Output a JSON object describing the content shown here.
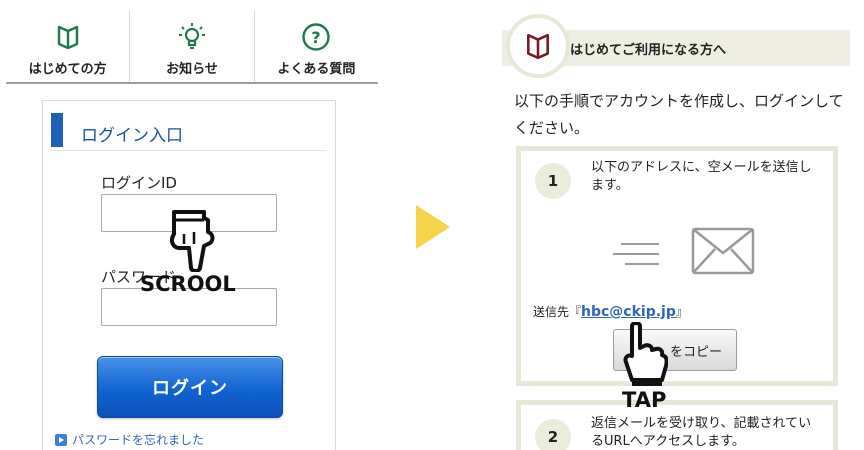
{
  "left": {
    "nav": [
      {
        "label": "はじめての方",
        "icon": "book-icon"
      },
      {
        "label": "お知らせ",
        "icon": "lightbulb-icon"
      },
      {
        "label": "よくある質問",
        "icon": "question-circle-icon"
      }
    ],
    "login": {
      "title": "ログイン入口",
      "id_label": "ログインID",
      "id_value": "",
      "password_label": "パスワード",
      "password_value": "",
      "button_label": "ログイン",
      "forgot_link": "パスワードを忘れました"
    },
    "gesture_label": "SCROOL"
  },
  "right": {
    "header_title": "はじめてご利用になる方へ",
    "intro": "以下の手順でアカウントを作成し、ログインしてください。",
    "steps": [
      {
        "number": "1",
        "text": "以下のアドレスに、空メールを送信します。"
      },
      {
        "number": "2",
        "text": "返信メールを受け取り、記載されているURLへアクセスします。"
      }
    ],
    "send_to_prefix": "送信先『",
    "send_to_address": "hbc@ckip.jp",
    "send_to_suffix": "』",
    "copy_button_label": "をコピー",
    "gesture_label": "TAP"
  },
  "colors": {
    "accent_green": "#1e7a4e",
    "login_blue": "#1163d2",
    "arrow_yellow": "#f6d34a",
    "link_blue": "#2f66b8"
  }
}
